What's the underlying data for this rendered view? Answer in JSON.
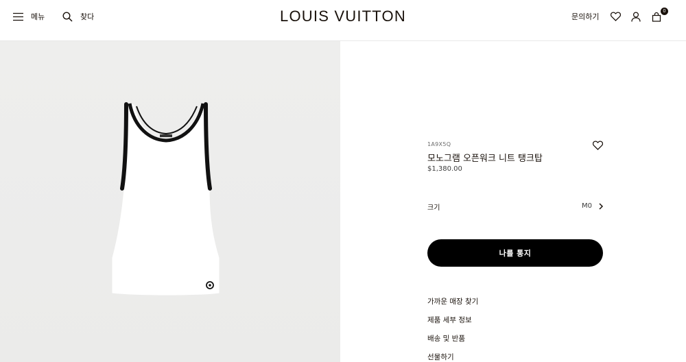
{
  "header": {
    "menu_label": "메뉴",
    "search_label": "찾다",
    "logo": "LOUIS VUITTON",
    "contact_label": "문의하기",
    "cart_count": "0"
  },
  "product": {
    "sku": "1A9X5Q",
    "title": "모노그램 오픈워크 니트 탱크탑",
    "price": "$1,380.00",
    "size_label": "크기",
    "size_value": "M0",
    "notify_button": "나를 통지",
    "links": [
      "가까운 매장 찾기",
      "제품 세부 정보",
      "배송 및 반품",
      "선물하기"
    ]
  },
  "colors": {
    "text": "#19110b",
    "button_bg": "#000000",
    "image_bg": "#eeeeed"
  },
  "icons": [
    "menu-icon",
    "search-icon",
    "heart-icon",
    "user-icon",
    "bag-icon",
    "chevron-right-icon"
  ]
}
